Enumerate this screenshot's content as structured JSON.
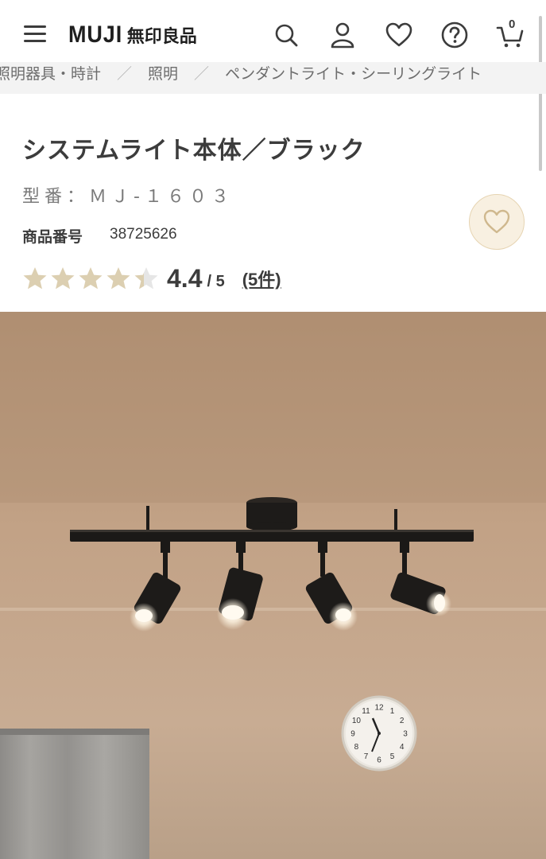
{
  "header": {
    "logo_en": "MUJI",
    "logo_ja": "無印良品",
    "cart_count": "0"
  },
  "breadcrumb": {
    "items": [
      "照明器具・時計",
      "照明",
      "ペンダントライト・シーリングライト"
    ]
  },
  "product": {
    "title": "システムライト本体／ブラック",
    "model": "型番：ＭＪ-１６０３",
    "number_label": "商品番号",
    "number_value": "38725626",
    "rating": {
      "value": 4.4,
      "score_text": "4.4",
      "max_text": "/ 5",
      "count_text": "(5件)"
    }
  },
  "colors": {
    "star_filled": "#dccfb1",
    "star_empty": "#e6e6e6",
    "favorite_bg": "#f8f0e1",
    "favorite_border": "#e6d4b2",
    "text": "#3c3c3c"
  },
  "icons": {
    "menu": "hamburger-icon",
    "search": "search-icon",
    "account": "user-icon",
    "favorites": "heart-icon",
    "help": "question-icon",
    "cart": "cart-icon"
  },
  "clock": {
    "numerals": [
      "12",
      "1",
      "2",
      "3",
      "4",
      "5",
      "6",
      "7",
      "8",
      "9",
      "10",
      "11"
    ]
  }
}
